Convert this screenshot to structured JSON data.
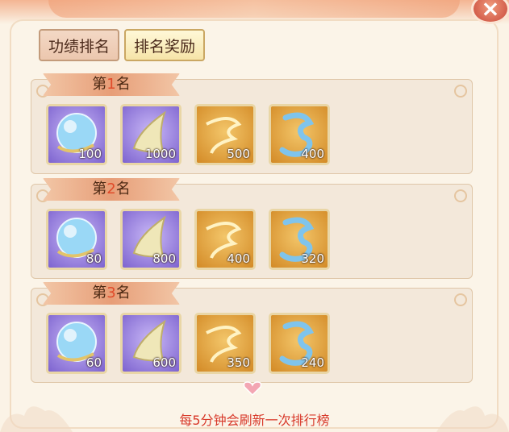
{
  "window": {
    "close_label": "×"
  },
  "tabs": [
    {
      "label": "功绩排名",
      "active": false
    },
    {
      "label": "排名奖励",
      "active": true
    }
  ],
  "ranks": [
    {
      "prefix": "第",
      "num": "1",
      "suffix": "名",
      "rewards": [
        {
          "icon": "crystal-orb-icon",
          "count": "100"
        },
        {
          "icon": "horn-icon",
          "count": "1000"
        },
        {
          "icon": "golden-wind-icon",
          "count": "500"
        },
        {
          "icon": "azure-dragon-icon",
          "count": "400"
        }
      ]
    },
    {
      "prefix": "第",
      "num": "2",
      "suffix": "名",
      "rewards": [
        {
          "icon": "crystal-orb-icon",
          "count": "80"
        },
        {
          "icon": "horn-icon",
          "count": "800"
        },
        {
          "icon": "golden-wind-icon",
          "count": "400"
        },
        {
          "icon": "azure-dragon-icon",
          "count": "320"
        }
      ]
    },
    {
      "prefix": "第",
      "num": "3",
      "suffix": "名",
      "rewards": [
        {
          "icon": "crystal-orb-icon",
          "count": "60"
        },
        {
          "icon": "horn-icon",
          "count": "600"
        },
        {
          "icon": "golden-wind-icon",
          "count": "350"
        },
        {
          "icon": "azure-dragon-icon",
          "count": "240"
        }
      ]
    }
  ],
  "footer": {
    "note": "每5分钟会刷新一次排行榜"
  },
  "colors": {
    "accent_red": "#e04b2a",
    "footer_red": "#d8392a",
    "purple_frame": "#7d63cf",
    "orange_frame": "#d38a26"
  }
}
